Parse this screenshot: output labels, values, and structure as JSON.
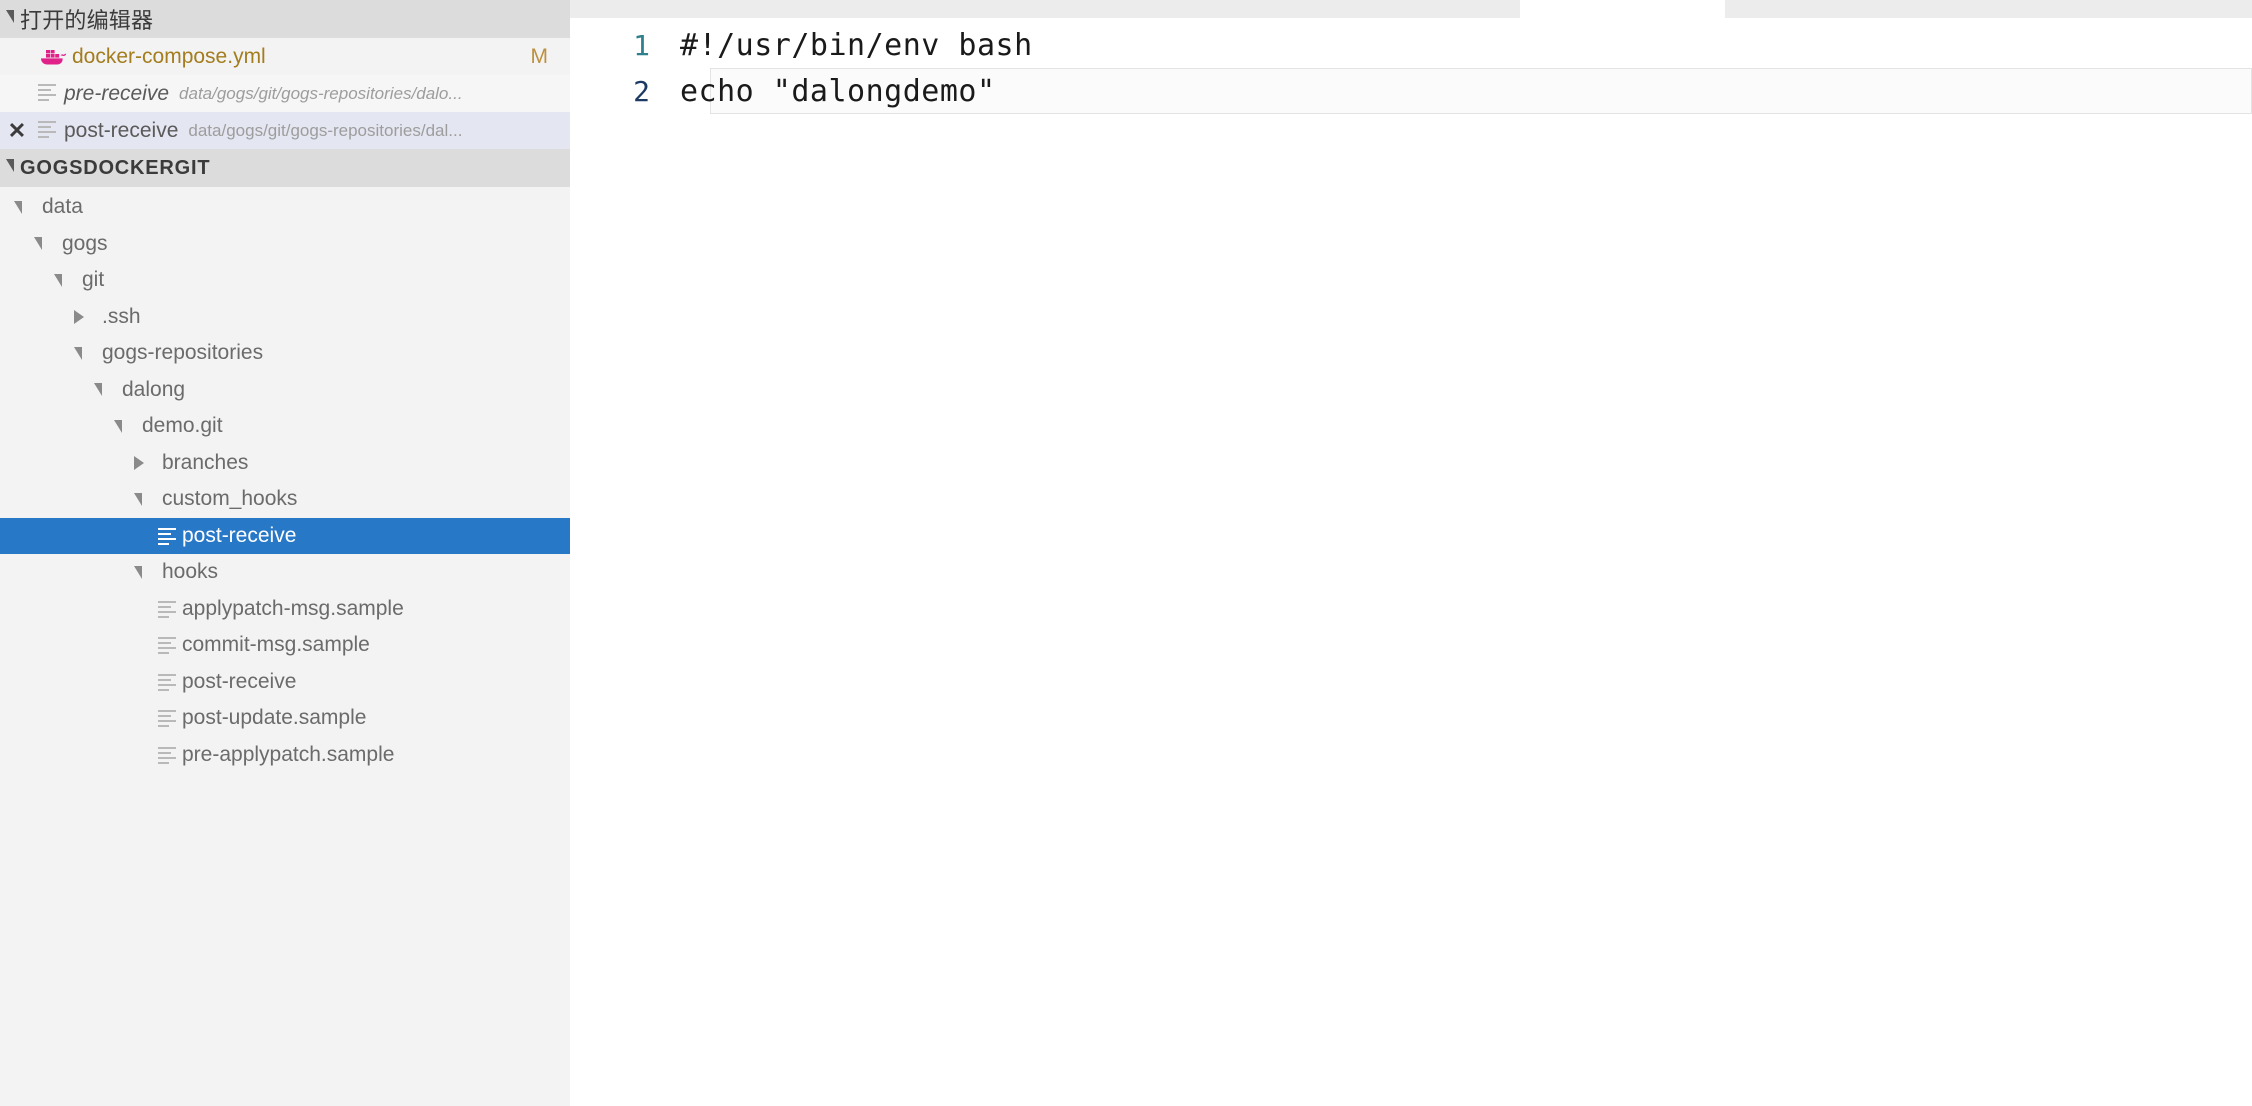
{
  "sidebar": {
    "open_editors": {
      "title": "打开的编辑器",
      "twisty": "chevron-down",
      "items": [
        {
          "name": "docker-compose.yml",
          "path": "",
          "icon": "docker-icon",
          "badge": "M",
          "state": "dirty",
          "close": ""
        },
        {
          "name": "pre-receive",
          "path": "data/gogs/git/gogs-repositories/dalo...",
          "icon": "file-lines-icon",
          "badge": "",
          "state": "preview",
          "close": ""
        },
        {
          "name": "post-receive",
          "path": "data/gogs/git/gogs-repositories/dal...",
          "icon": "file-lines-icon",
          "badge": "",
          "state": "active",
          "close": "✕"
        }
      ]
    },
    "project": {
      "title": "GOGSDOCKERGIT",
      "twisty": "chevron-down"
    },
    "tree": [
      {
        "label": "data",
        "depth": 0,
        "type": "folder",
        "expanded": true,
        "selected": false
      },
      {
        "label": "gogs",
        "depth": 1,
        "type": "folder",
        "expanded": true,
        "selected": false
      },
      {
        "label": "git",
        "depth": 2,
        "type": "folder",
        "expanded": true,
        "selected": false
      },
      {
        "label": ".ssh",
        "depth": 3,
        "type": "folder",
        "expanded": false,
        "selected": false
      },
      {
        "label": "gogs-repositories",
        "depth": 3,
        "type": "folder",
        "expanded": true,
        "selected": false
      },
      {
        "label": "dalong",
        "depth": 4,
        "type": "folder",
        "expanded": true,
        "selected": false
      },
      {
        "label": "demo.git",
        "depth": 5,
        "type": "folder",
        "expanded": true,
        "selected": false
      },
      {
        "label": "branches",
        "depth": 6,
        "type": "folder",
        "expanded": false,
        "selected": false
      },
      {
        "label": "custom_hooks",
        "depth": 6,
        "type": "folder",
        "expanded": true,
        "selected": false
      },
      {
        "label": "post-receive",
        "depth": 7,
        "type": "file",
        "expanded": false,
        "selected": true
      },
      {
        "label": "hooks",
        "depth": 6,
        "type": "folder",
        "expanded": true,
        "selected": false
      },
      {
        "label": "applypatch-msg.sample",
        "depth": 7,
        "type": "file",
        "expanded": false,
        "selected": false
      },
      {
        "label": "commit-msg.sample",
        "depth": 7,
        "type": "file",
        "expanded": false,
        "selected": false
      },
      {
        "label": "post-receive",
        "depth": 7,
        "type": "file",
        "expanded": false,
        "selected": false
      },
      {
        "label": "post-update.sample",
        "depth": 7,
        "type": "file",
        "expanded": false,
        "selected": false
      },
      {
        "label": "pre-applypatch.sample",
        "depth": 7,
        "type": "file",
        "expanded": false,
        "selected": false
      }
    ]
  },
  "editor": {
    "lines": [
      {
        "number": "1",
        "text": "#!/usr/bin/env bash",
        "current": false
      },
      {
        "number": "2",
        "text": "echo \"dalongdemo\"",
        "current": true
      }
    ]
  },
  "colors": {
    "selection_blue": "#2878c8",
    "sidebar_bg": "#f3f3f3",
    "section_header_bg": "#dcdcdc",
    "active_editor_bg": "#e4e6f1",
    "modified_badge": "#bd9040",
    "docker_icon": "#e0218a",
    "linenum_inactive": "#2f7f8c",
    "linenum_active": "#1c3a63"
  }
}
